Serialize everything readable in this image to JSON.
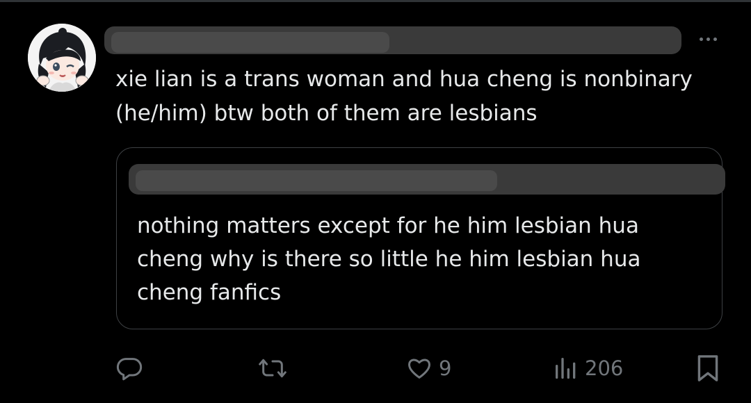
{
  "tweet": {
    "text_line_1": "xie lian is a trans woman and hua cheng is nonbinary",
    "text_line_2": "(he/him) btw both of them are lesbians"
  },
  "quoted_tweet": {
    "text_line_1": "nothing matters except for he him lesbian hua",
    "text_line_2": "cheng why is there so little he him lesbian hua",
    "text_line_3": "cheng fanfics"
  },
  "actions": {
    "like_count": "9",
    "view_count": "206"
  },
  "icons": {
    "reply": "reply-icon",
    "retweet": "retweet-icon",
    "like": "heart-icon",
    "views": "views-chart-icon",
    "bookmark": "bookmark-icon",
    "more": "more-dots-icon"
  },
  "colors": {
    "background": "#000000",
    "text": "#e7e9ea",
    "muted": "#71767b",
    "border": "#3e4144"
  }
}
